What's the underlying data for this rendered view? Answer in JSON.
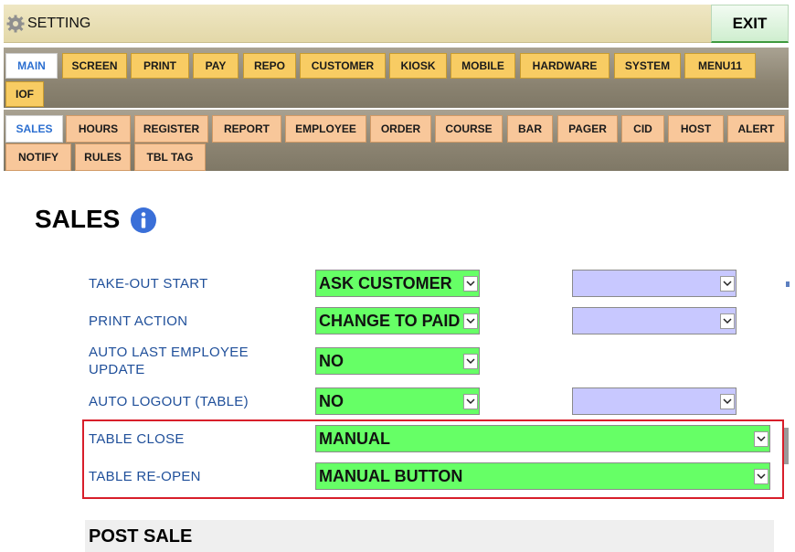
{
  "window": {
    "title": "SETTING",
    "exit_label": "EXIT"
  },
  "main_tabs": [
    {
      "label": "MAIN",
      "active": true
    },
    {
      "label": "SCREEN"
    },
    {
      "label": "PRINT"
    },
    {
      "label": "PAY"
    },
    {
      "label": "REPO"
    },
    {
      "label": "CUSTOMER"
    },
    {
      "label": "KIOSK"
    },
    {
      "label": "MOBILE"
    },
    {
      "label": "HARDWARE"
    },
    {
      "label": "SYSTEM"
    },
    {
      "label": "MENU11"
    },
    {
      "label": "IOF"
    }
  ],
  "sub_tabs": [
    {
      "label": "SALES",
      "active": true
    },
    {
      "label": "HOURS"
    },
    {
      "label": "REGISTER"
    },
    {
      "label": "REPORT"
    },
    {
      "label": "EMPLOYEE"
    },
    {
      "label": "ORDER"
    },
    {
      "label": "COURSE"
    },
    {
      "label": "BAR"
    },
    {
      "label": "PAGER"
    },
    {
      "label": "CID"
    },
    {
      "label": "HOST"
    },
    {
      "label": "ALERT"
    },
    {
      "label": "NOTIFY"
    },
    {
      "label": "RULES"
    },
    {
      "label": "TBL TAG"
    }
  ],
  "page": {
    "title": "SALES"
  },
  "settings": [
    {
      "label": "TAKE-OUT START",
      "value": "ASK CUSTOMER",
      "secondary": ""
    },
    {
      "label": "PRINT ACTION",
      "value": "CHANGE TO PAID",
      "secondary": ""
    },
    {
      "label": "AUTO LAST EMPLOYEE",
      "label2": "UPDATE",
      "value": "NO"
    },
    {
      "label": "AUTO LOGOUT (TABLE)",
      "value": "NO",
      "secondary": ""
    },
    {
      "label": "TABLE CLOSE",
      "value": "MANUAL"
    },
    {
      "label": "TABLE RE-OPEN",
      "value": "MANUAL BUTTON"
    }
  ],
  "sections": {
    "post_sale": "POST SALE"
  },
  "colors": {
    "select_on": "#66ff66",
    "select_empty": "#c8c8ff",
    "highlight": "#d81e2a",
    "label": "#1f4f9a"
  }
}
